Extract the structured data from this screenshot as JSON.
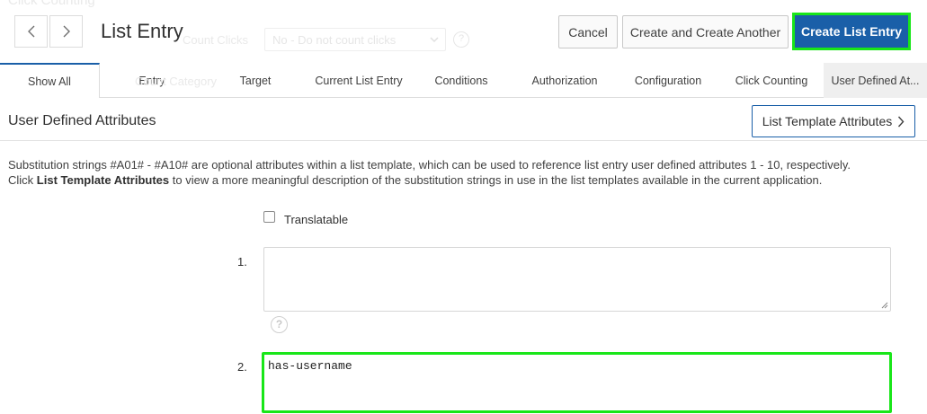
{
  "ghost": {
    "heading": "Click Counting",
    "count_clicks_label": "Count Clicks",
    "count_clicks_value": "No - Do not count clicks",
    "category_label": "Count Category"
  },
  "header": {
    "title": "List Entry",
    "cancel_label": "Cancel",
    "create_another_label": "Create and Create Another",
    "create_label": "Create List Entry"
  },
  "tabs": [
    {
      "label": "Show All"
    },
    {
      "label": "Entry"
    },
    {
      "label": "Target"
    },
    {
      "label": "Current List Entry"
    },
    {
      "label": "Conditions"
    },
    {
      "label": "Authorization"
    },
    {
      "label": "Configuration"
    },
    {
      "label": "Click Counting"
    },
    {
      "label": "User Defined At..."
    }
  ],
  "section": {
    "title": "User Defined Attributes",
    "list_attrs_button": "List Template Attributes",
    "desc_line1": "Substitution strings #A01# - #A10# are optional attributes within a list template, which can be used to reference list entry user defined attributes 1 - 10, respectively.",
    "desc_line2_pre": "Click ",
    "desc_line2_bold": "List Template Attributes",
    "desc_line2_post": " to view a more meaningful description of the substitution strings in use in the list templates available in the current application."
  },
  "form": {
    "translatable_label": "Translatable",
    "attr1_label": "1.",
    "attr1_value": "",
    "attr2_label": "2.",
    "attr2_value": "has-username"
  },
  "colors": {
    "primary": "#1a5fa8",
    "highlight": "#19e619"
  }
}
